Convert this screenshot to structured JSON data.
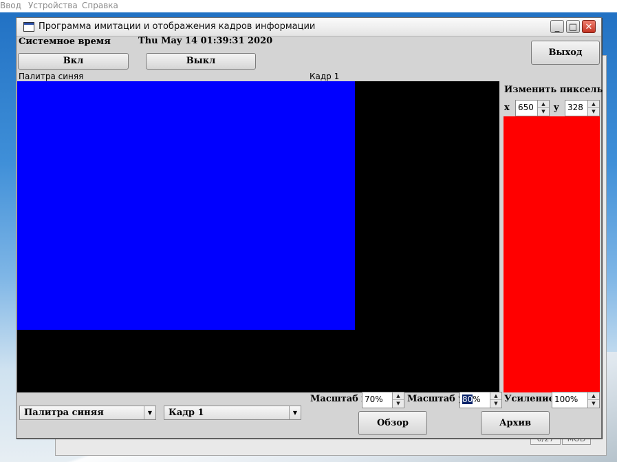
{
  "outer_menu": [
    "Ввод",
    "Устройства",
    "Справка"
  ],
  "outer_status": [
    "0/27",
    "MOD"
  ],
  "window": {
    "title": "Программа имитации и отображения кадров информации",
    "minimize_glyph": "_",
    "maximize_glyph": "□",
    "close_glyph": "✕"
  },
  "header": {
    "system_time_label": "Системное время",
    "system_time_value": "Thu May 14 01:39:31 2020",
    "on_button": "Вкл",
    "off_button": "Выкл",
    "exit_button": "Выход"
  },
  "canvas": {
    "palette_caption": "Палитра синяя",
    "frame_caption": "Кадр 1",
    "palette_color": "#0000ff",
    "background_color": "#000000"
  },
  "pixel_editor": {
    "title": "Изменить пиксель",
    "x_label": "x",
    "x_value": "650",
    "y_label": "y",
    "y_value": "328",
    "swatch_color": "#ff0000"
  },
  "controls": {
    "palette_select": "Палитра синяя",
    "frame_select": "Кадр 1",
    "scale_x_label": "Масштаб x",
    "scale_x_value": "70%",
    "scale_y_label": "Масштаб у",
    "scale_y_selected": "80",
    "scale_y_suffix": "%",
    "gain_label": "Усиление",
    "gain_value": "100%",
    "browse_button": "Обзор",
    "archive_button": "Архив"
  }
}
